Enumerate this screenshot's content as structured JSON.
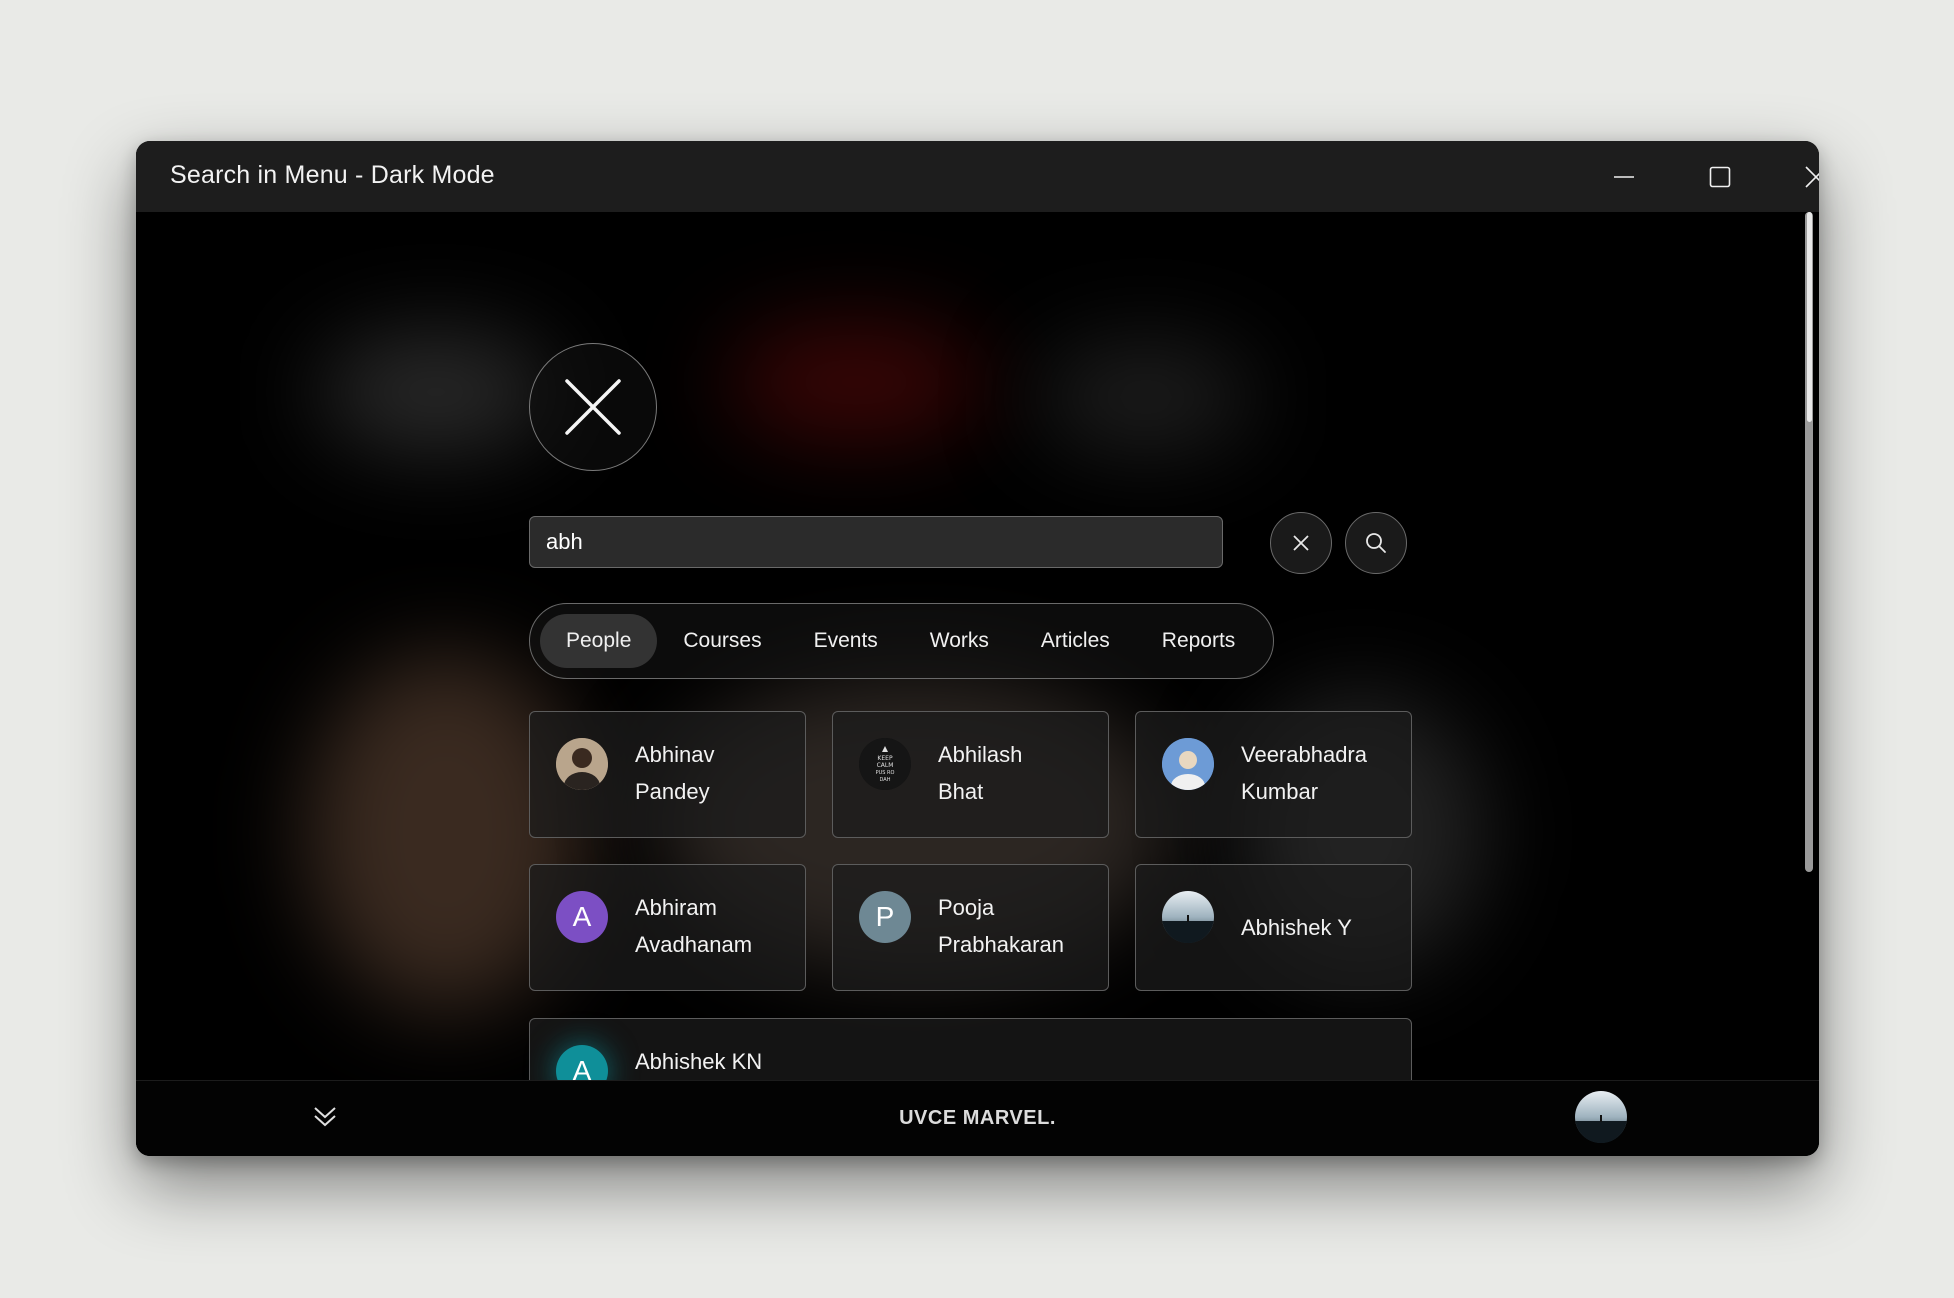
{
  "window": {
    "title": "Search in Menu - Dark Mode",
    "controls": [
      "minimize",
      "maximize",
      "close"
    ]
  },
  "search": {
    "value": "abh",
    "placeholder": "",
    "clear_icon": "close-icon",
    "search_icon": "search-icon"
  },
  "tabs": [
    {
      "label": "People",
      "active": true
    },
    {
      "label": "Courses",
      "active": false
    },
    {
      "label": "Events",
      "active": false
    },
    {
      "label": "Works",
      "active": false
    },
    {
      "label": "Articles",
      "active": false
    },
    {
      "label": "Reports",
      "active": false
    }
  ],
  "results": [
    {
      "first": "Abhinav",
      "last": "Pandey",
      "avatar": "photo"
    },
    {
      "first": "Abhilash",
      "last": "Bhat",
      "avatar": "photo"
    },
    {
      "first": "Veerabhadra",
      "last": "Kumbar",
      "avatar": "photo"
    },
    {
      "first": "Abhiram",
      "last": "Avadhanam",
      "avatar": "A",
      "avatar_color": "#7c4fc4"
    },
    {
      "first": "Pooja",
      "last": "Prabhakaran",
      "avatar": "P",
      "avatar_color": "#6e8894"
    },
    {
      "first": "Abhishek Y",
      "last": "",
      "avatar": "photo"
    },
    {
      "first": "Abhishek KN",
      "last": "",
      "avatar": "A",
      "avatar_color": "#0f8f99"
    }
  ],
  "avatar_badge_text": "KEEP CALM AND PUS RO DAH",
  "footer": {
    "brand": "UVCE MARVEL."
  }
}
